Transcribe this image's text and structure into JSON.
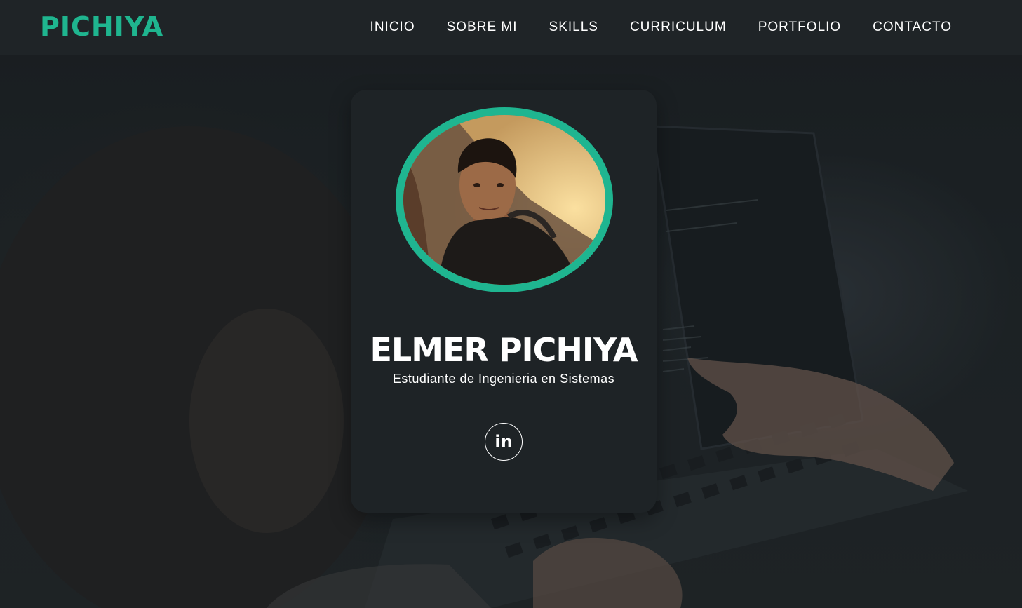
{
  "brand": {
    "name": "PICHIYA",
    "accent_color": "#1fb58f"
  },
  "nav": {
    "items": [
      {
        "label": "INICIO"
      },
      {
        "label": "SOBRE MI"
      },
      {
        "label": "SKILLS"
      },
      {
        "label": "CURRICULUM"
      },
      {
        "label": "PORTFOLIO"
      },
      {
        "label": "CONTACTO"
      }
    ]
  },
  "profile": {
    "name": "ELMER PICHIYA",
    "role": "Estudiante de Ingenieria en Sistemas",
    "ring_color": "#1fb590",
    "avatar_alt": "profile-photo"
  },
  "social": {
    "linkedin": {
      "glyph": "in",
      "icon": "linkedin-icon"
    }
  },
  "background": {
    "scene": "laptop-keyboard-dark"
  }
}
